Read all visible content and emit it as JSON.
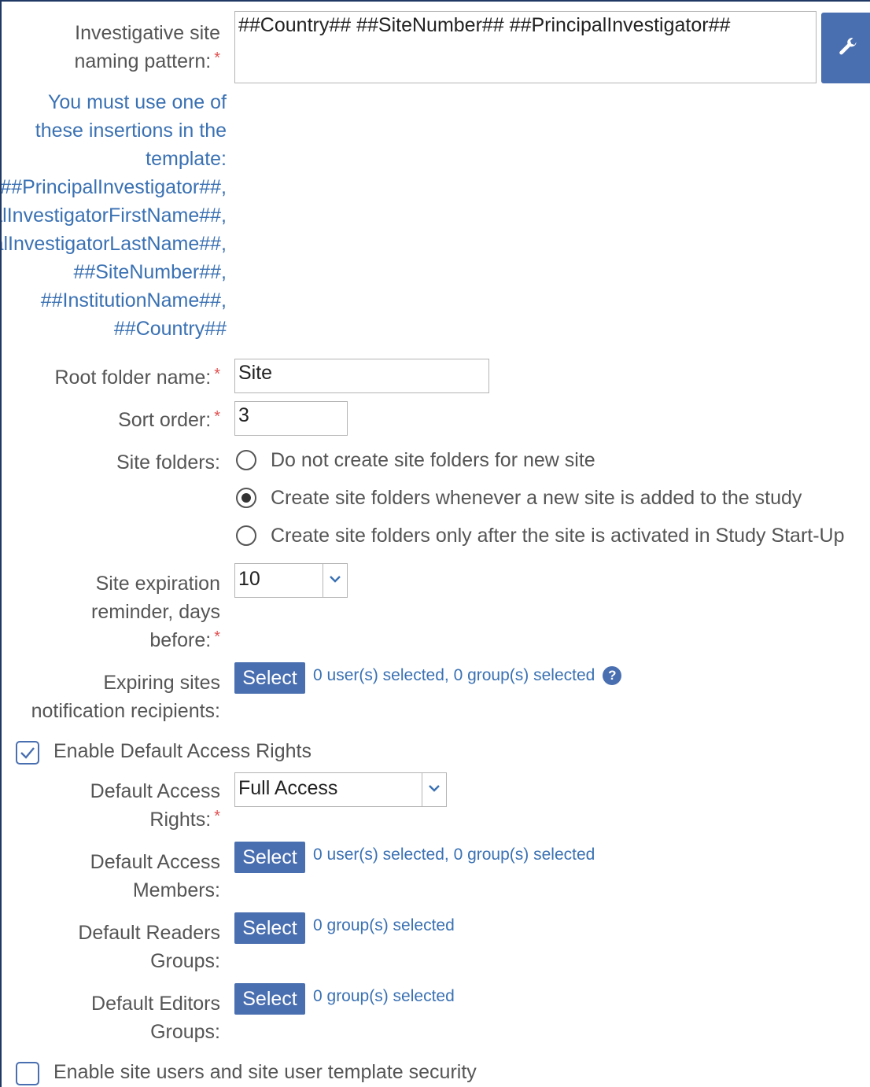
{
  "naming_pattern": {
    "label_line1": "Investigative site",
    "label_line2": "naming pattern:",
    "required_mark": "*",
    "value": "##Country## ##SiteNumber## ##PrincipalInvestigator##",
    "tool_icon": "wrench-icon",
    "hint_lines": [
      "You must use one of",
      "these insertions in the",
      "template:",
      "##PrincipalInvestigator##,",
      "##PrincipalInvestigatorFirstName##,",
      "##PrincipalInvestigatorLastName##,",
      "##SiteNumber##,",
      "##InstitutionName##,",
      "##Country##"
    ]
  },
  "root_folder": {
    "label": "Root folder name:",
    "required_mark": "*",
    "value": "Site"
  },
  "sort_order": {
    "label": "Sort order:",
    "required_mark": "*",
    "value": "3"
  },
  "site_folders": {
    "label": "Site folders:",
    "options": [
      {
        "label": "Do not create site folders for new site",
        "checked": false
      },
      {
        "label": "Create site folders whenever a new site is added to the study",
        "checked": true
      },
      {
        "label": "Create site folders only after the site is activated in Study Start-Up",
        "checked": false
      }
    ]
  },
  "expiration_reminder": {
    "label_line1": "Site expiration",
    "label_line2": "reminder, days",
    "label_line3": "before:",
    "required_mark": "*",
    "value": "10"
  },
  "expiring_recipients": {
    "label_line1": "Expiring sites",
    "label_line2": "notification recipients:",
    "button_label": "Select",
    "selection_text": "0 user(s) selected, 0 group(s) selected",
    "help_icon": "question-circle-icon",
    "help_glyph": "?"
  },
  "enable_default_access": {
    "label": "Enable Default Access Rights",
    "checked": true
  },
  "default_access_rights": {
    "label_line1": "Default Access",
    "label_line2": "Rights:",
    "required_mark": "*",
    "value": "Full Access"
  },
  "default_access_members": {
    "label_line1": "Default Access",
    "label_line2": "Members:",
    "button_label": "Select",
    "selection_text": "0 user(s) selected, 0 group(s) selected"
  },
  "default_readers": {
    "label_line1": "Default Readers",
    "label_line2": "Groups:",
    "button_label": "Select",
    "selection_text": "0 group(s) selected"
  },
  "default_editors": {
    "label_line1": "Default Editors",
    "label_line2": "Groups:",
    "button_label": "Select",
    "selection_text": "0 group(s) selected"
  },
  "enable_site_users": {
    "label": "Enable site users and site user template security",
    "checked": false
  }
}
